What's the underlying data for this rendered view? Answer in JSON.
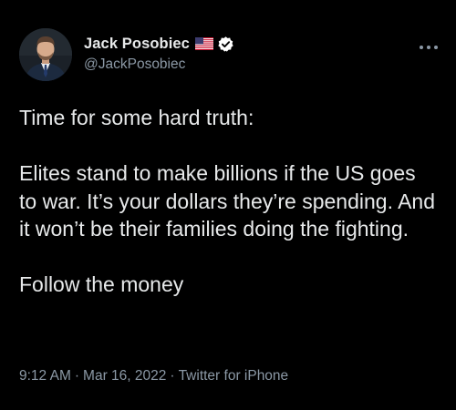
{
  "author": {
    "display_name": "Jack Posobiec",
    "handle": "@JackPosobiec",
    "flag_icon": "us-flag-icon",
    "verified_icon": "verified-badge-icon",
    "verified_color": "#ffffff"
  },
  "menu": {
    "icon": "more-options-icon"
  },
  "tweet": {
    "paragraphs": [
      "Time for some hard truth:",
      "Elites stand to make billions if the US goes to war. It’s your dollars they’re spending. And it won’t be their families doing the fighting.",
      "Follow the money"
    ]
  },
  "meta": {
    "time": "9:12 AM",
    "separator": "·",
    "date": "Mar 16, 2022",
    "source": "Twitter for iPhone"
  },
  "colors": {
    "background": "#000000",
    "text": "#e7e9ea",
    "secondary": "#8b98a5"
  }
}
